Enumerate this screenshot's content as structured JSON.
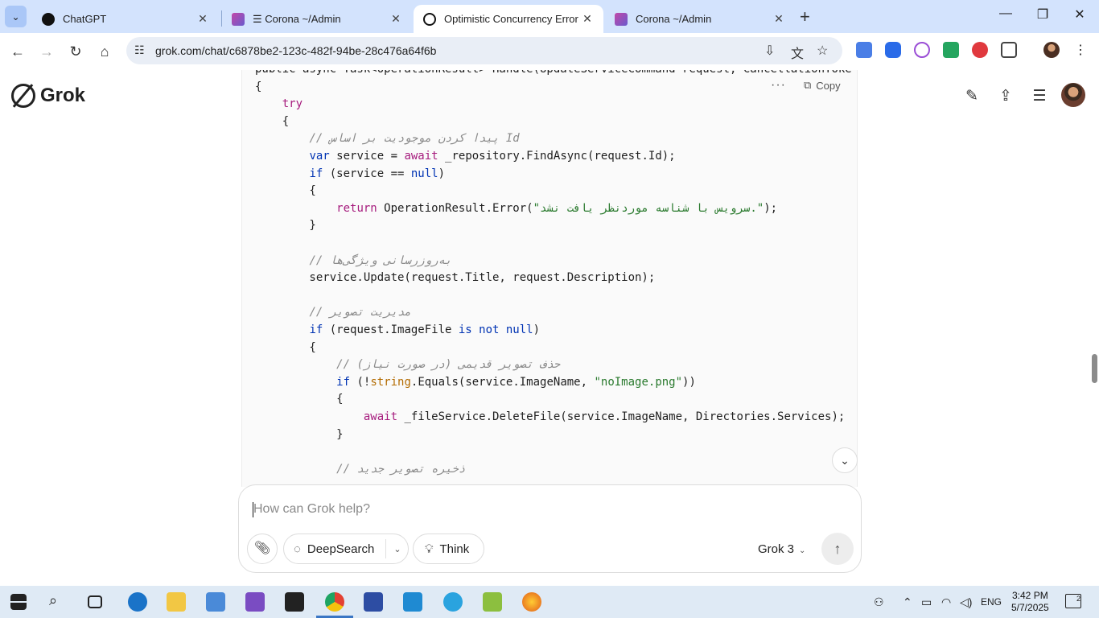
{
  "browser": {
    "tabs": [
      {
        "title": "ChatGPT",
        "close": "✕",
        "favicon_color": "#111111"
      },
      {
        "title": "☰ Corona ~/Admin",
        "close": "✕",
        "favicon_color": "#c248a8"
      },
      {
        "title": "Optimistic Concurrency Error in",
        "close": "✕",
        "favicon_color": "#111111"
      },
      {
        "title": "Corona ~/Admin",
        "close": "✕",
        "favicon_color": "#c248a8"
      }
    ],
    "new_tab": "+",
    "url": "grok.com/chat/c6878be2-123c-482f-94be-28c476a64f6b"
  },
  "grok": {
    "logo_text": "Grok",
    "copy_label": "Copy",
    "code_lines": [
      [
        {
          "t": "public async Task<OperationResult> Handle(UpdateServiceCommand request, CancellationToke",
          "c": "plain"
        }
      ],
      [
        {
          "t": "{",
          "c": "plain"
        }
      ],
      [
        {
          "t": "    ",
          "c": "plain"
        },
        {
          "t": "try",
          "c": "kw2"
        }
      ],
      [
        {
          "t": "    {",
          "c": "plain"
        }
      ],
      [
        {
          "t": "        ",
          "c": "plain"
        },
        {
          "t": "// پیدا کردن موجودیت بر اساس Id",
          "c": "cmt"
        }
      ],
      [
        {
          "t": "        ",
          "c": "plain"
        },
        {
          "t": "var",
          "c": "kw"
        },
        {
          "t": " service = ",
          "c": "plain"
        },
        {
          "t": "await",
          "c": "kw2"
        },
        {
          "t": " _repository.FindAsync(request.Id);",
          "c": "plain"
        }
      ],
      [
        {
          "t": "        ",
          "c": "plain"
        },
        {
          "t": "if",
          "c": "kw"
        },
        {
          "t": " (service == ",
          "c": "plain"
        },
        {
          "t": "null",
          "c": "kw"
        },
        {
          "t": ")",
          "c": "plain"
        }
      ],
      [
        {
          "t": "        {",
          "c": "plain"
        }
      ],
      [
        {
          "t": "            ",
          "c": "plain"
        },
        {
          "t": "return",
          "c": "kw2"
        },
        {
          "t": " OperationResult.Error(",
          "c": "plain"
        },
        {
          "t": "\"سرویس با شناسه موردنظر یافت نشد.\"",
          "c": "str"
        },
        {
          "t": ");",
          "c": "plain"
        }
      ],
      [
        {
          "t": "        }",
          "c": "plain"
        }
      ],
      [
        {
          "t": "",
          "c": "plain"
        }
      ],
      [
        {
          "t": "        ",
          "c": "plain"
        },
        {
          "t": "// به‌روزرسانی ویژگی‌ها",
          "c": "cmt"
        }
      ],
      [
        {
          "t": "        service.Update(request.Title, request.Description);",
          "c": "plain"
        }
      ],
      [
        {
          "t": "",
          "c": "plain"
        }
      ],
      [
        {
          "t": "        ",
          "c": "plain"
        },
        {
          "t": "// مدیریت تصویر",
          "c": "cmt"
        }
      ],
      [
        {
          "t": "        ",
          "c": "plain"
        },
        {
          "t": "if",
          "c": "kw"
        },
        {
          "t": " (request.ImageFile ",
          "c": "plain"
        },
        {
          "t": "is not null",
          "c": "kw"
        },
        {
          "t": ")",
          "c": "plain"
        }
      ],
      [
        {
          "t": "        {",
          "c": "plain"
        }
      ],
      [
        {
          "t": "            ",
          "c": "plain"
        },
        {
          "t": "// حذف تصویر قدیمی (در صورت نیاز)",
          "c": "cmt"
        }
      ],
      [
        {
          "t": "            ",
          "c": "plain"
        },
        {
          "t": "if",
          "c": "kw"
        },
        {
          "t": " (!",
          "c": "plain"
        },
        {
          "t": "string",
          "c": "typ"
        },
        {
          "t": ".Equals(service.ImageName, ",
          "c": "plain"
        },
        {
          "t": "\"noImage.png\"",
          "c": "str"
        },
        {
          "t": "))",
          "c": "plain"
        }
      ],
      [
        {
          "t": "            {",
          "c": "plain"
        }
      ],
      [
        {
          "t": "                ",
          "c": "plain"
        },
        {
          "t": "await",
          "c": "kw2"
        },
        {
          "t": " _fileService.DeleteFile(service.ImageName, Directories.Services);",
          "c": "plain"
        }
      ],
      [
        {
          "t": "            }",
          "c": "plain"
        }
      ],
      [
        {
          "t": "",
          "c": "plain"
        }
      ],
      [
        {
          "t": "            ",
          "c": "plain"
        },
        {
          "t": "// ذخیره تصویر جدید",
          "c": "cmt"
        }
      ]
    ]
  },
  "composer": {
    "placeholder": "How can Grok help?",
    "deepsearch_label": "DeepSearch",
    "think_label": "Think",
    "model_label": "Grok 3"
  },
  "taskbar": {
    "language": "ENG",
    "time": "3:42 PM",
    "date": "5/7/2025",
    "notifications": "2"
  }
}
